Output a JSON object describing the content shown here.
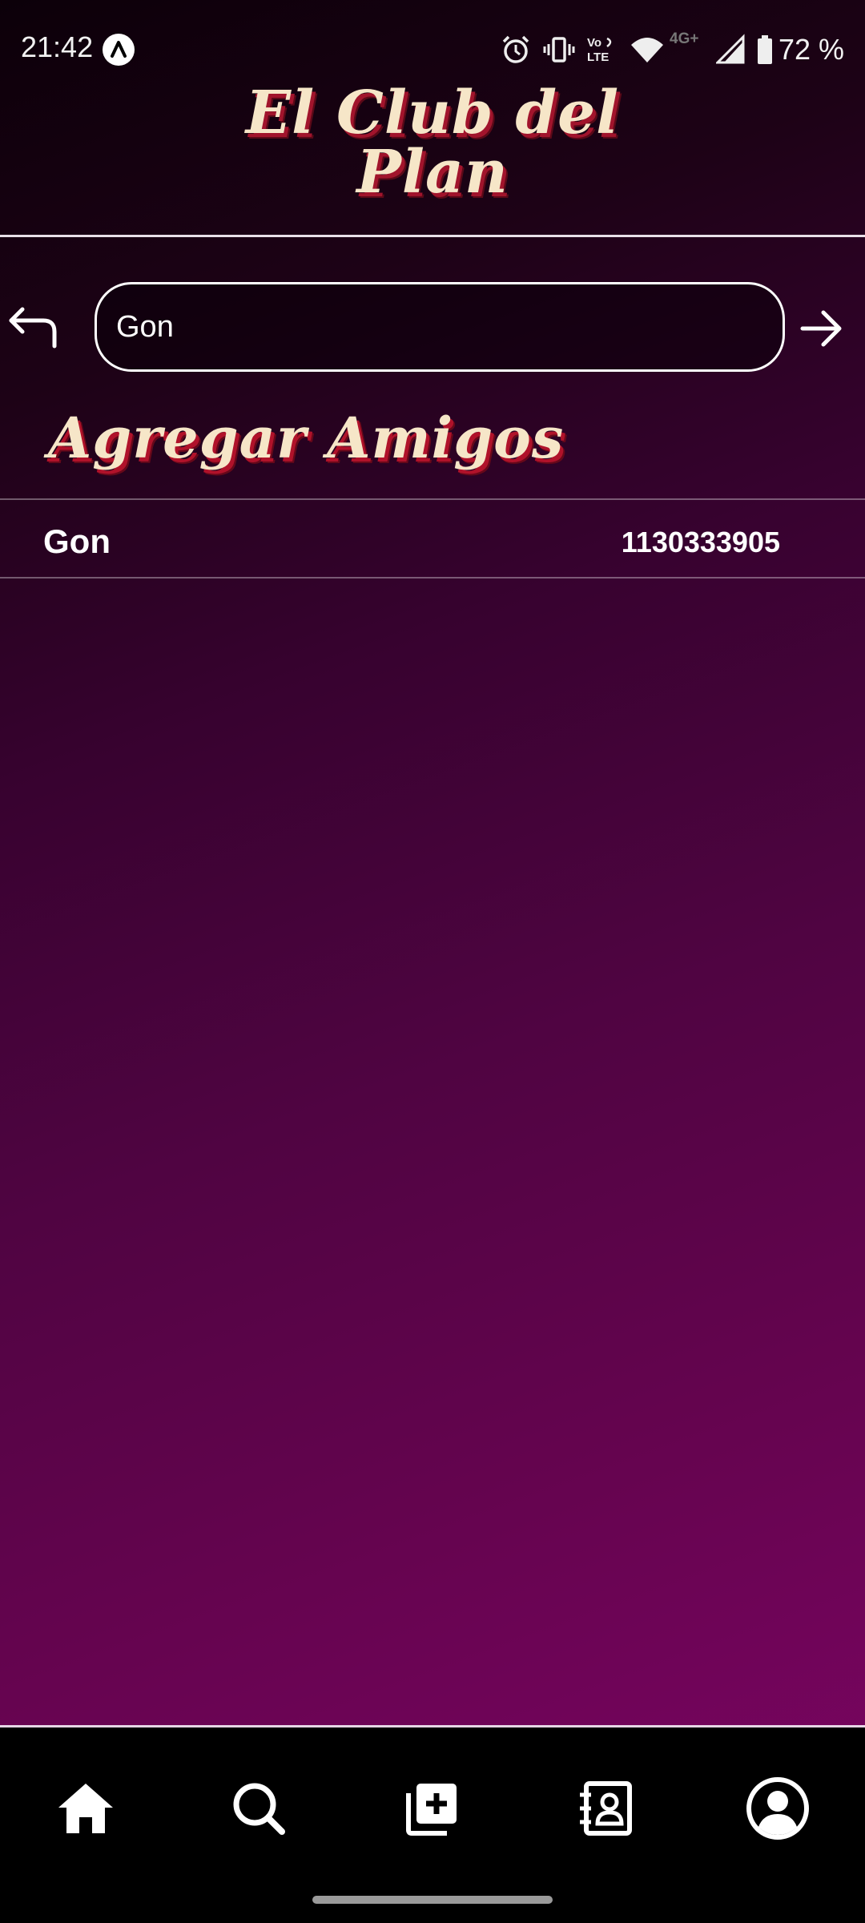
{
  "status_bar": {
    "time": "21:42",
    "battery": "72 %",
    "icons": [
      "alarm-icon",
      "vibrate-icon",
      "volte-icon",
      "wifi-icon",
      "4g-icon",
      "signal-icon",
      "battery-icon"
    ],
    "network": "4G+",
    "volte": {
      "top": "Vo",
      "bottom": "LTE"
    }
  },
  "header": {
    "title_line1": "El Club del",
    "title_line2": "Plan"
  },
  "search": {
    "value": "Gon",
    "placeholder": ""
  },
  "section": {
    "title": "Agregar Amigos"
  },
  "results": [
    {
      "name": "Gon",
      "phone": "1130333905"
    }
  ],
  "bottom_nav": {
    "items": [
      "home-icon",
      "search-icon",
      "add-icon",
      "contacts-icon",
      "profile-icon"
    ]
  },
  "colors": {
    "title_cream": "#f6e6c8",
    "title_shadow": "#a1142c",
    "bg_top": "#0c0009",
    "bg_bottom": "#7d0564"
  }
}
